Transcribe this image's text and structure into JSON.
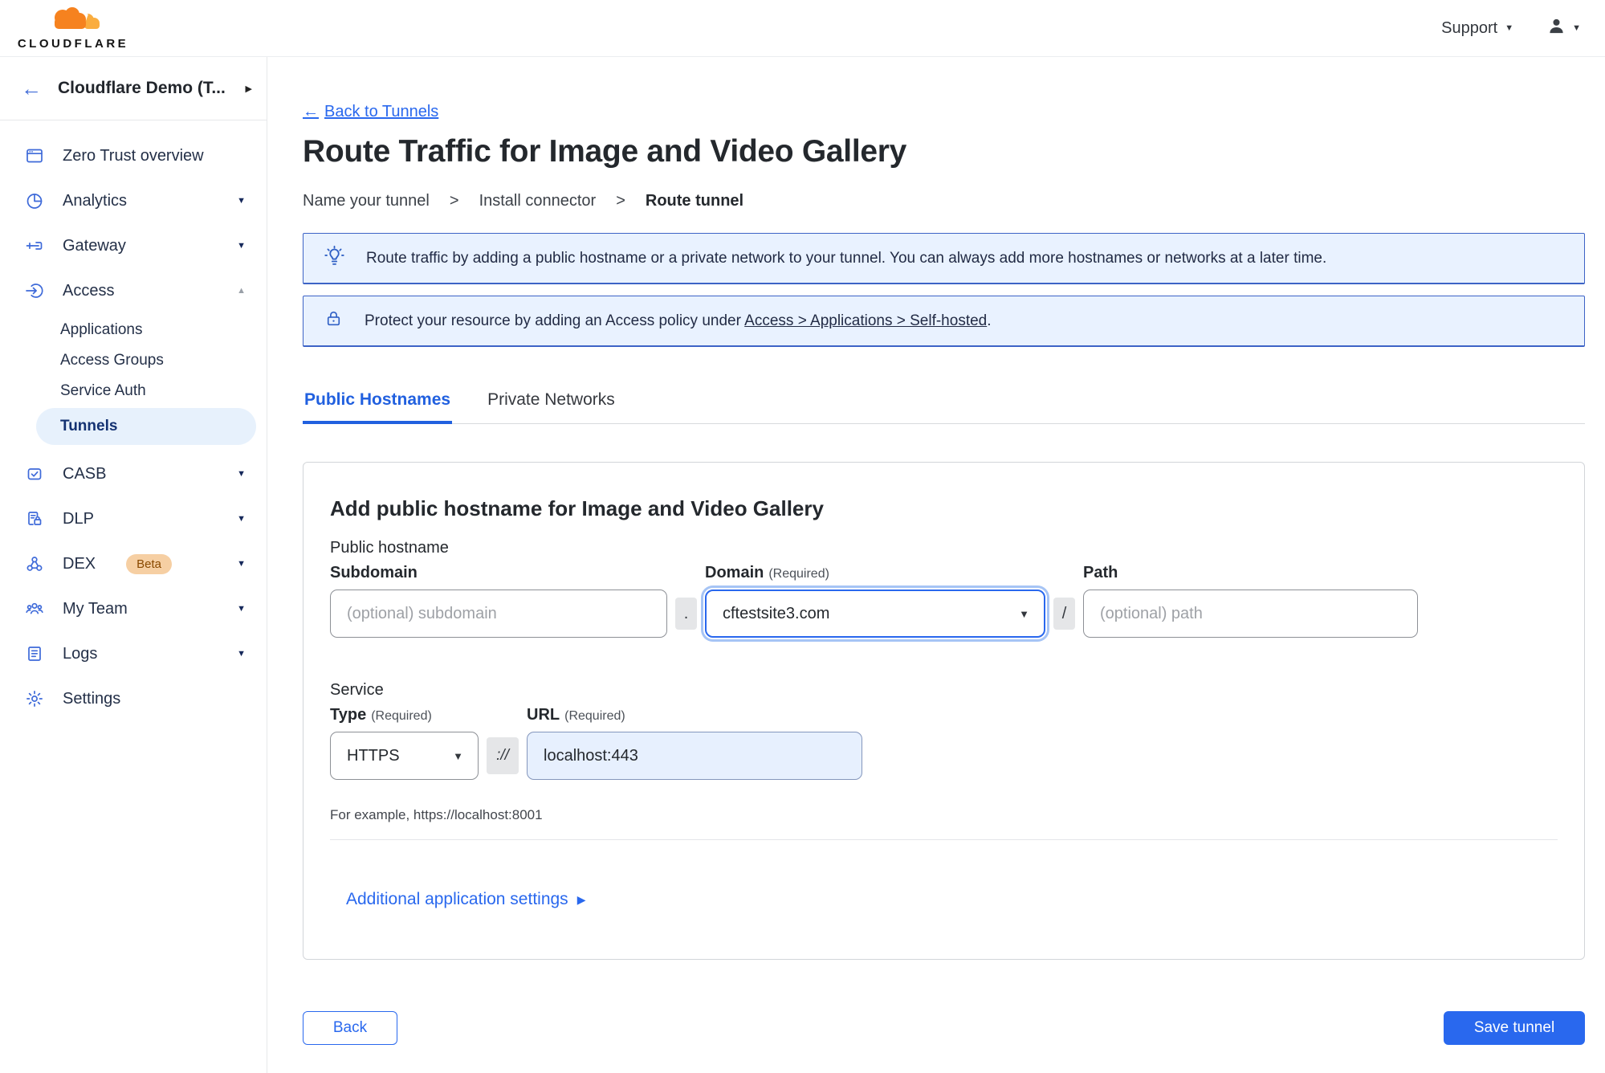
{
  "icons": {
    "back_arrow": "←",
    "chevron_down": "▼",
    "chevron_up": "▲",
    "chevron_right": "▶",
    "select_caret": "▼",
    "step_separator": ">"
  },
  "header": {
    "logo_text": "CLOUDFLARE",
    "support_label": "Support"
  },
  "sidebar": {
    "account_name": "Cloudflare Demo (T...",
    "items": [
      {
        "label": "Zero Trust overview"
      },
      {
        "label": "Analytics"
      },
      {
        "label": "Gateway"
      },
      {
        "label": "Access"
      },
      {
        "label": "CASB"
      },
      {
        "label": "DLP"
      },
      {
        "label": "DEX",
        "badge": "Beta"
      },
      {
        "label": "My Team"
      },
      {
        "label": "Logs"
      },
      {
        "label": "Settings"
      }
    ],
    "access_subitems": [
      {
        "label": "Applications"
      },
      {
        "label": "Access Groups"
      },
      {
        "label": "Service Auth"
      },
      {
        "label": "Tunnels",
        "active": true
      }
    ]
  },
  "main": {
    "back_link": "Back to Tunnels",
    "title": "Route Traffic for Image and Video Gallery",
    "steps": [
      "Name your tunnel",
      "Install connector",
      "Route tunnel"
    ],
    "banner_info": "Route traffic by adding a public hostname or a private network to your tunnel. You can always add more hostnames or networks at a later time.",
    "banner_protect_prefix": "Protect your resource by adding an Access policy under",
    "banner_protect_link": "Access > Applications > Self-hosted",
    "banner_protect_suffix": ".",
    "tabs": [
      "Public Hostnames",
      "Private Networks"
    ]
  },
  "card": {
    "heading": "Add public hostname for Image and Video Gallery",
    "section_public_hostname": "Public hostname",
    "subdomain_label": "Subdomain",
    "subdomain_placeholder": "(optional) subdomain",
    "dot_separator": ".",
    "domain_label": "Domain",
    "domain_required": "(Required)",
    "domain_value": "cftestsite3.com",
    "slash_separator": "/",
    "path_label": "Path",
    "path_placeholder": "(optional) path",
    "section_service": "Service",
    "type_label": "Type",
    "type_required": "(Required)",
    "type_value": "HTTPS",
    "scheme_separator": "://",
    "url_label": "URL",
    "url_required": "(Required)",
    "url_value": "localhost:443",
    "example_text": "For example, https://localhost:8001",
    "additional_settings": "Additional application settings"
  },
  "footer": {
    "back_label": "Back",
    "save_label": "Save tunnel"
  },
  "colors": {
    "primary_blue": "#2968ee",
    "sidebar_icon_blue": "#3e6ad9",
    "banner_bg": "#e9f2ff",
    "banner_border": "#3d63c6",
    "active_pill_bg": "#e7f1fc",
    "beta_badge_bg": "#f6cfa3",
    "url_input_bg": "#e7f0fe",
    "logo_orange": "#f6821f",
    "logo_light_orange": "#faad3f"
  }
}
